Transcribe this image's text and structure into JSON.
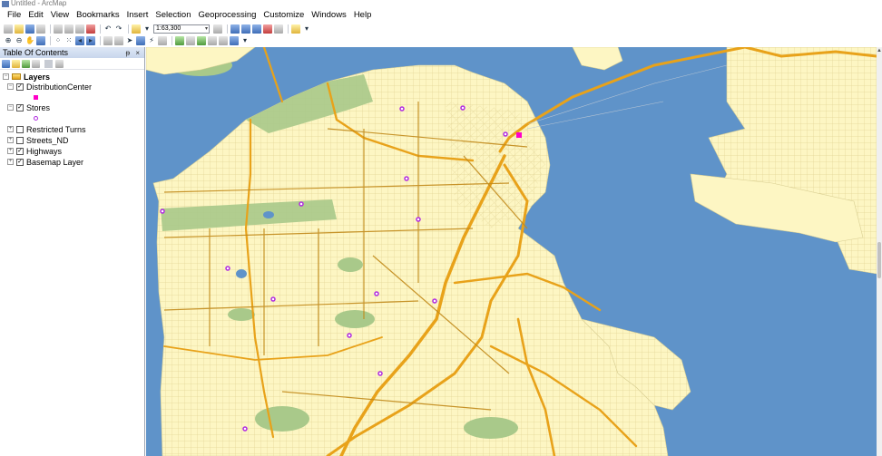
{
  "app": {
    "title": "Untitled - ArcMap"
  },
  "menu": [
    "File",
    "Edit",
    "View",
    "Bookmarks",
    "Insert",
    "Selection",
    "Geoprocessing",
    "Customize",
    "Windows",
    "Help"
  ],
  "toolbar": {
    "scale": "1:63,300"
  },
  "toc": {
    "title": "Table Of Contents",
    "pin_glyphs": "ᵽ ×",
    "root": "Layers",
    "layers": [
      {
        "name": "DistributionCenter",
        "checked": true,
        "symbol": "pink-square",
        "symbol_color": "#ff00c8"
      },
      {
        "name": "Stores",
        "checked": true,
        "symbol": "purple-circle",
        "symbol_color": "#b12ce0"
      },
      {
        "name": "Restricted Turns",
        "checked": false
      },
      {
        "name": "Streets_ND",
        "checked": false
      },
      {
        "name": "Highways",
        "checked": true
      },
      {
        "name": "Basemap Layer",
        "checked": true
      }
    ]
  },
  "map": {
    "water_color": "#5f93c9",
    "land_color": "#fdf6c3",
    "park_color": "#a9c98a",
    "highway_color": "#e8a21a",
    "arterial_color": "#c28a1a",
    "distribution_center_color": "#ff00c8",
    "store_color": "#b12ce0",
    "store_count": 14
  }
}
